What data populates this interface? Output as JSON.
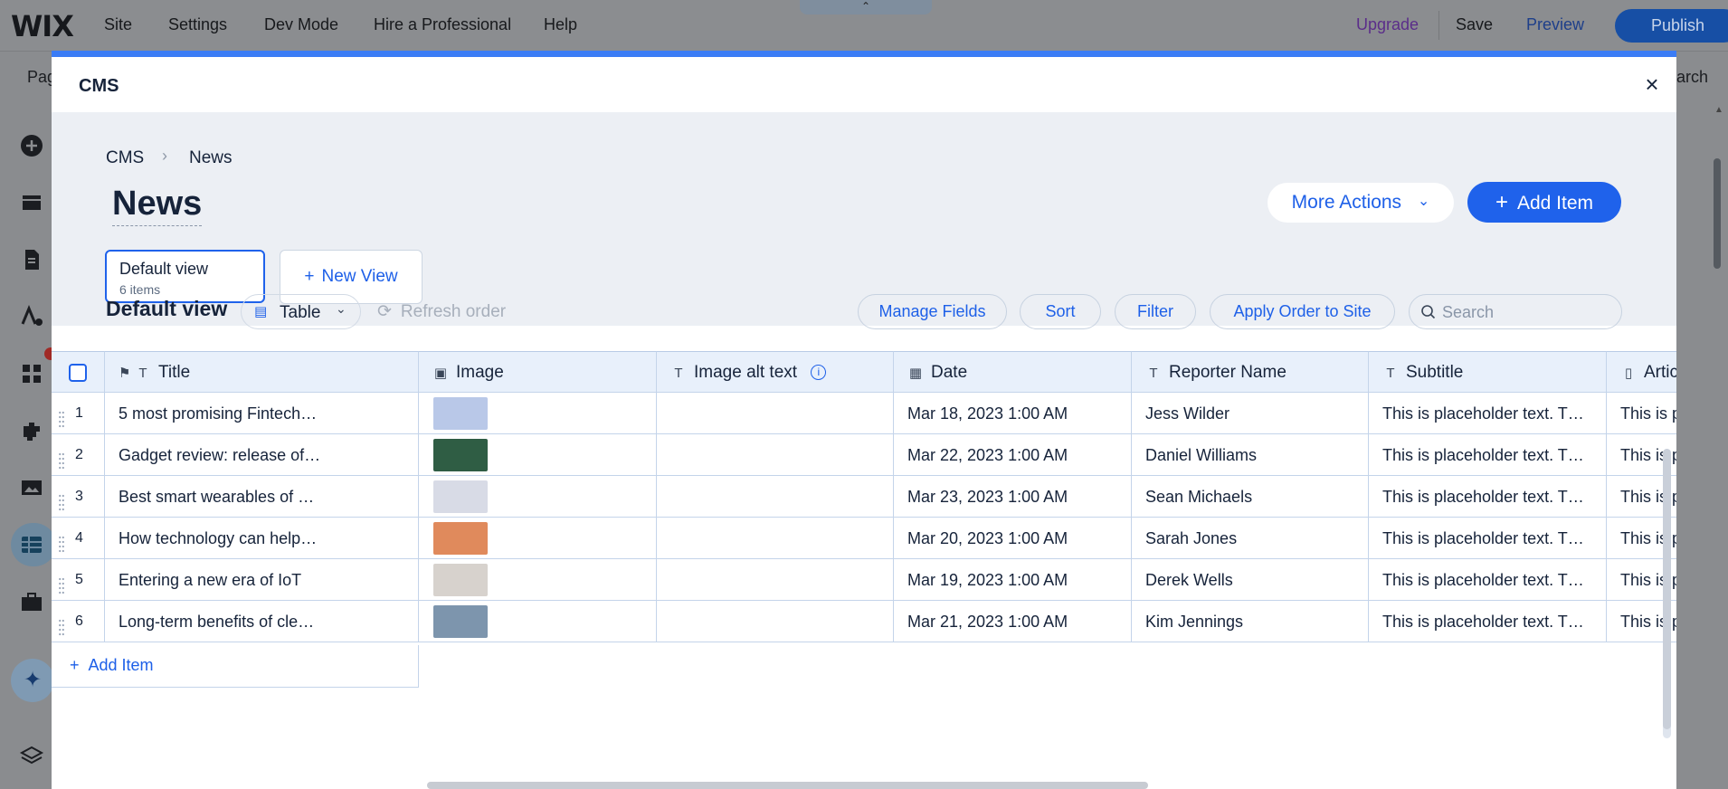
{
  "editor": {
    "logo": "WIX",
    "menu": [
      "Site",
      "Settings",
      "Dev Mode",
      "Hire a Professional",
      "Help"
    ],
    "upgrade": "Upgrade",
    "save": "Save",
    "preview": "Preview",
    "publish": "Publish",
    "second_bar_left": "Pag",
    "second_bar_right": "arch",
    "top_handle": "⌃"
  },
  "modal": {
    "title": "CMS",
    "close": "×",
    "breadcrumb": {
      "root": "CMS",
      "separator": "›",
      "current": "News"
    },
    "page_title": "News",
    "more_actions": "More Actions",
    "more_actions_chevron": "⌄",
    "add_item": "Add Item",
    "views": {
      "active": {
        "name": "Default view",
        "count": "6 items"
      },
      "new_view": "New View"
    },
    "toolbar": {
      "view_label": "Default view",
      "layout_select": "Table",
      "refresh_order": "Refresh order",
      "manage_fields": "Manage Fields",
      "sort": "Sort",
      "filter": "Filter",
      "apply_order": "Apply Order to Site",
      "search_placeholder": "Search"
    },
    "table": {
      "columns": [
        {
          "label": "Title",
          "icon": "text-icon"
        },
        {
          "label": "Image",
          "icon": "image-icon"
        },
        {
          "label": "Image alt text",
          "icon": "text-icon"
        },
        {
          "label": "Date",
          "icon": "calendar-icon"
        },
        {
          "label": "Reporter Name",
          "icon": "text-icon"
        },
        {
          "label": "Subtitle",
          "icon": "text-icon"
        },
        {
          "label": "Artic",
          "icon": "document-icon"
        }
      ],
      "rows": [
        {
          "n": "1",
          "title": "5 most promising Fintech…",
          "date": "Mar 18, 2023 1:00 AM",
          "reporter": "Jess Wilder",
          "subtitle": "This is placeholder text. T…",
          "article": "This is p",
          "thumb": "#b9c8e8"
        },
        {
          "n": "2",
          "title": "Gadget review: release of…",
          "date": "Mar 22, 2023 1:00 AM",
          "reporter": "Daniel Williams",
          "subtitle": "This is placeholder text. T…",
          "article": "This is p",
          "thumb": "#2f5d44"
        },
        {
          "n": "3",
          "title": "Best smart wearables of …",
          "date": "Mar 23, 2023 1:00 AM",
          "reporter": "Sean Michaels",
          "subtitle": "This is placeholder text. T…",
          "article": "This is p",
          "thumb": "#d8dbe6"
        },
        {
          "n": "4",
          "title": "How technology can help…",
          "date": "Mar 20, 2023 1:00 AM",
          "reporter": "Sarah Jones",
          "subtitle": "This is placeholder text. T…",
          "article": "This is p",
          "thumb": "#e08a5c"
        },
        {
          "n": "5",
          "title": "Entering a new era of IoT",
          "date": "Mar 19, 2023 1:00 AM",
          "reporter": "Derek Wells",
          "subtitle": "This is placeholder text. T…",
          "article": "This is p",
          "thumb": "#d7d2cd"
        },
        {
          "n": "6",
          "title": "Long-term benefits of cle…",
          "date": "Mar 21, 2023 1:00 AM",
          "reporter": "Kim Jennings",
          "subtitle": "This is placeholder text. T…",
          "article": "This is p",
          "thumb": "#7d95ad"
        }
      ],
      "add_row": "Add Item"
    }
  },
  "colors": {
    "accent": "#1f62eb",
    "modal_topline": "#3b7cf5",
    "upgrade": "#5b2d8a",
    "preview": "#1e3f8a"
  }
}
